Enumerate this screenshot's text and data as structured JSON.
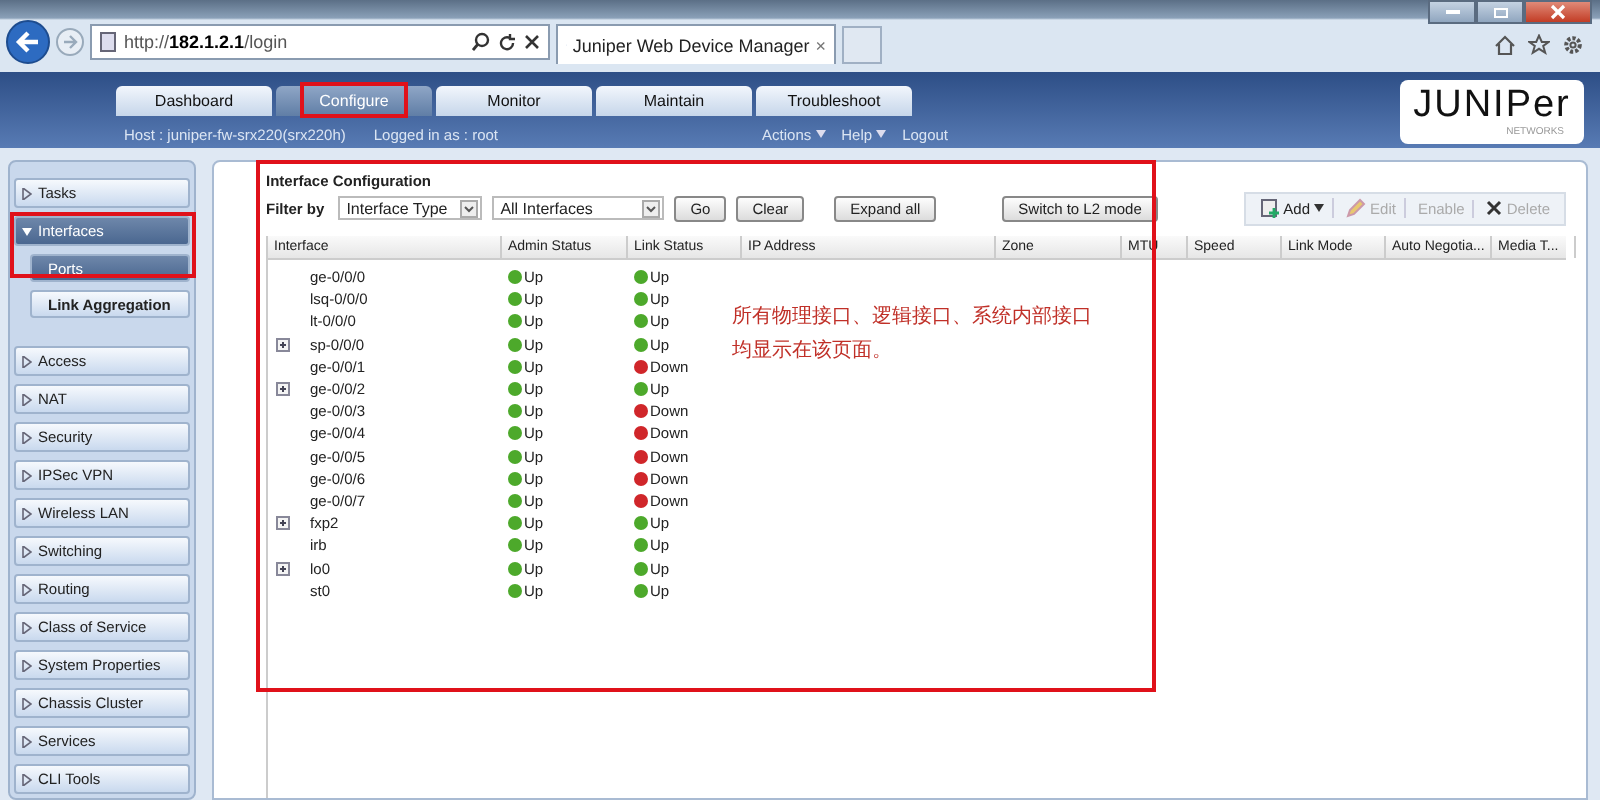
{
  "browser": {
    "address": "http://**182.1.2.1**/login",
    "tab_title": "Juniper Web Device Manager",
    "tab_close": "×"
  },
  "header": {
    "tabs": [
      {
        "label": "Dashboard",
        "selected": false
      },
      {
        "label": "Configure",
        "selected": true
      },
      {
        "label": "Monitor",
        "selected": false
      },
      {
        "label": "Maintain",
        "selected": false
      },
      {
        "label": "Troubleshoot",
        "selected": false
      }
    ],
    "host": "Host : juniper-fw-srx220(srx220h)",
    "logged_in": "Logged in as : root",
    "links": [
      {
        "label": "Actions",
        "menu": true
      },
      {
        "label": "Help",
        "menu": true
      },
      {
        "label": "Logout",
        "menu": false
      }
    ],
    "logo": "JUNIPer",
    "logo_sub": "NETWORKS"
  },
  "sidebar": {
    "items": [
      {
        "label": "Tasks",
        "expanded": false,
        "selected": false
      },
      {
        "label": "Interfaces",
        "expanded": true,
        "selected": true,
        "children": [
          {
            "label": "Ports",
            "selected": true
          },
          {
            "label": "Link Aggregation",
            "selected": false
          }
        ]
      },
      {
        "label": "Access",
        "expanded": false,
        "selected": false
      },
      {
        "label": "NAT",
        "expanded": false,
        "selected": false
      },
      {
        "label": "Security",
        "expanded": false,
        "selected": false
      },
      {
        "label": "IPSec VPN",
        "expanded": false,
        "selected": false
      },
      {
        "label": "Wireless LAN",
        "expanded": false,
        "selected": false
      },
      {
        "label": "Switching",
        "expanded": false,
        "selected": false
      },
      {
        "label": "Routing",
        "expanded": false,
        "selected": false
      },
      {
        "label": "Class of Service",
        "expanded": false,
        "selected": false
      },
      {
        "label": "System Properties",
        "expanded": false,
        "selected": false
      },
      {
        "label": "Chassis Cluster",
        "expanded": false,
        "selected": false
      },
      {
        "label": "Services",
        "expanded": false,
        "selected": false
      },
      {
        "label": "CLI Tools",
        "expanded": false,
        "selected": false
      }
    ]
  },
  "panel": {
    "title": "Interface Configuration",
    "filter_label": "Filter by",
    "filter_type": "Interface Type",
    "filter_value": "All Interfaces",
    "buttons": [
      "Go",
      "Clear",
      "Expand all",
      "Switch to L2 mode"
    ],
    "toolbar": [
      {
        "label": "Add",
        "disabled": false,
        "kind": "add"
      },
      {
        "label": "Edit",
        "disabled": true,
        "kind": "edit"
      },
      {
        "label": "Enable",
        "disabled": true,
        "kind": "plain"
      },
      {
        "label": "Delete",
        "disabled": true,
        "kind": "delete"
      }
    ],
    "columns": [
      "Interface",
      "Admin Status",
      "Link Status",
      "IP Address",
      "Zone",
      "MTU",
      "Speed",
      "Link Mode",
      "Auto Negotia...",
      "Media T..."
    ],
    "rows": [
      {
        "name": "ge-0/0/0",
        "expandable": false,
        "admin": {
          "text": "Up",
          "up": true
        },
        "link": {
          "text": "Up",
          "up": true
        }
      },
      {
        "name": "lsq-0/0/0",
        "expandable": false,
        "admin": {
          "text": "Up",
          "up": true
        },
        "link": {
          "text": "Up",
          "up": true
        }
      },
      {
        "name": "lt-0/0/0",
        "expandable": false,
        "admin": {
          "text": "Up",
          "up": true
        },
        "link": {
          "text": "Up",
          "up": true
        }
      },
      {
        "name": "sp-0/0/0",
        "expandable": true,
        "admin": {
          "text": "Up",
          "up": true
        },
        "link": {
          "text": "Up",
          "up": true
        }
      },
      {
        "name": "ge-0/0/1",
        "expandable": false,
        "admin": {
          "text": "Up",
          "up": true
        },
        "link": {
          "text": "Down",
          "up": false
        }
      },
      {
        "name": "ge-0/0/2",
        "expandable": true,
        "admin": {
          "text": "Up",
          "up": true
        },
        "link": {
          "text": "Up",
          "up": true
        }
      },
      {
        "name": "ge-0/0/3",
        "expandable": false,
        "admin": {
          "text": "Up",
          "up": true
        },
        "link": {
          "text": "Down",
          "up": false
        }
      },
      {
        "name": "ge-0/0/4",
        "expandable": false,
        "admin": {
          "text": "Up",
          "up": true
        },
        "link": {
          "text": "Down",
          "up": false
        }
      },
      {
        "name": "ge-0/0/5",
        "expandable": false,
        "admin": {
          "text": "Up",
          "up": true
        },
        "link": {
          "text": "Down",
          "up": false
        }
      },
      {
        "name": "ge-0/0/6",
        "expandable": false,
        "admin": {
          "text": "Up",
          "up": true
        },
        "link": {
          "text": "Down",
          "up": false
        }
      },
      {
        "name": "ge-0/0/7",
        "expandable": false,
        "admin": {
          "text": "Up",
          "up": true
        },
        "link": {
          "text": "Down",
          "up": false
        }
      },
      {
        "name": "fxp2",
        "expandable": true,
        "admin": {
          "text": "Up",
          "up": true
        },
        "link": {
          "text": "Up",
          "up": true
        }
      },
      {
        "name": "irb",
        "expandable": false,
        "admin": {
          "text": "Up",
          "up": true
        },
        "link": {
          "text": "Up",
          "up": true
        }
      },
      {
        "name": "lo0",
        "expandable": true,
        "admin": {
          "text": "Up",
          "up": true
        },
        "link": {
          "text": "Up",
          "up": true
        }
      },
      {
        "name": "st0",
        "expandable": false,
        "admin": {
          "text": "Up",
          "up": true
        },
        "link": {
          "text": "Up",
          "up": true
        }
      }
    ],
    "note": [
      "所有物理接口、逻辑接口、系统内部接口",
      "均显示在该页面。"
    ]
  }
}
